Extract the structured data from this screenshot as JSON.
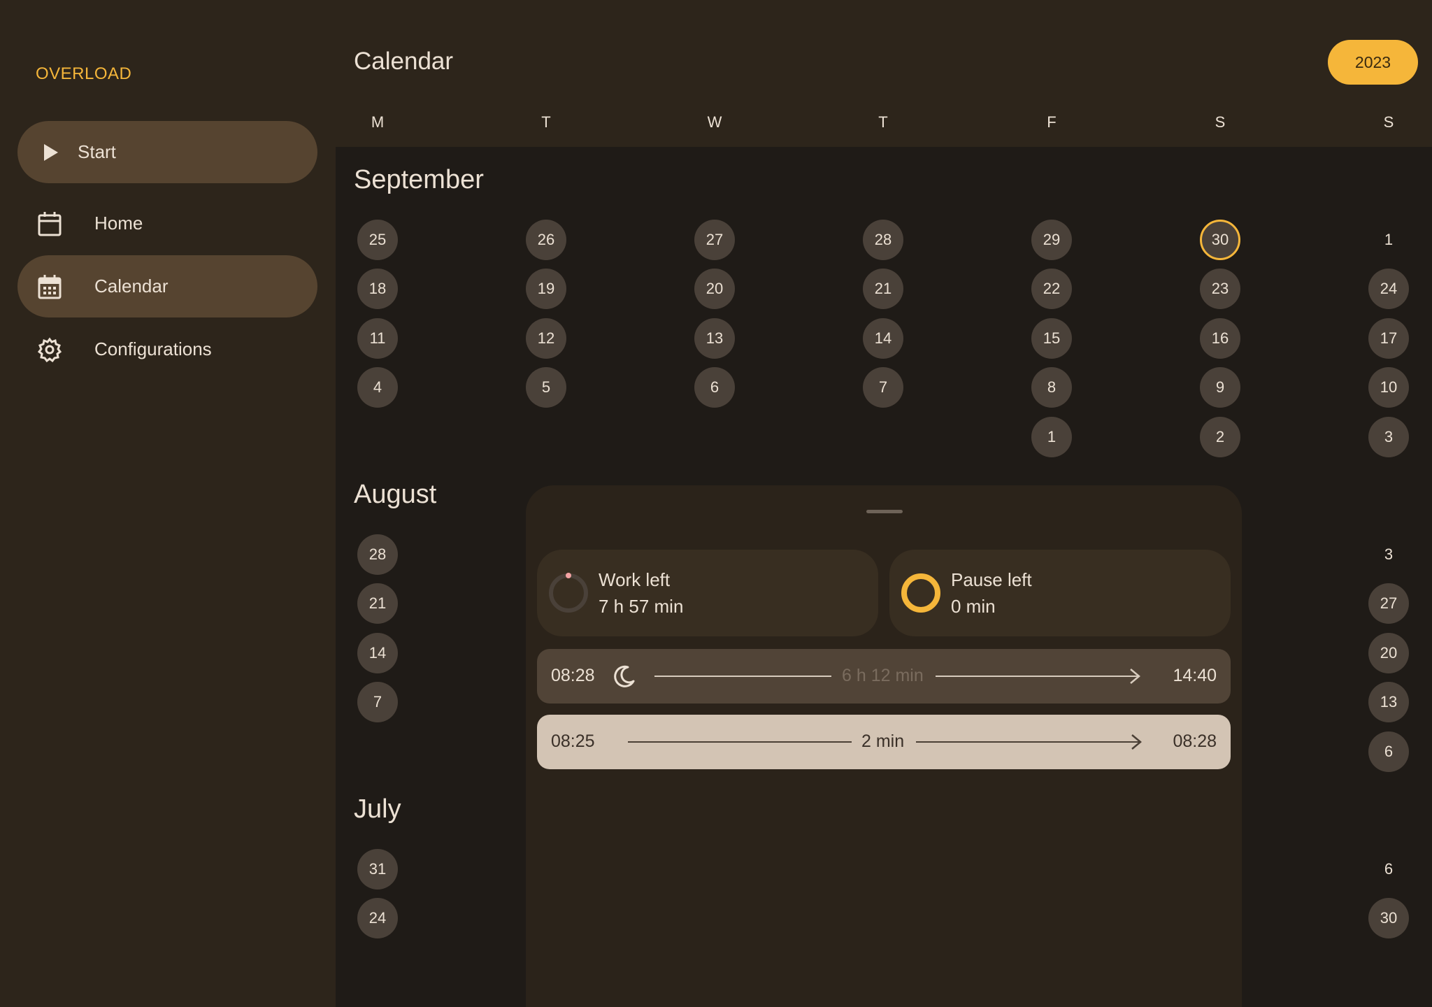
{
  "app": {
    "brand": "OVERLOAD"
  },
  "nav": {
    "start_label": "Start",
    "items": [
      {
        "label": "Home",
        "icon": "calendar-outline-icon"
      },
      {
        "label": "Calendar",
        "icon": "calendar-filled-icon",
        "active": true
      },
      {
        "label": "Configurations",
        "icon": "gear-icon"
      }
    ]
  },
  "header": {
    "title": "Calendar",
    "year": "2023"
  },
  "weekdays": [
    "M",
    "T",
    "W",
    "T",
    "F",
    "S",
    "S"
  ],
  "months": [
    {
      "name": "September",
      "rows": [
        [
          "25",
          "26",
          "27",
          "28",
          "29",
          "30",
          "1"
        ],
        [
          "18",
          "19",
          "20",
          "21",
          "22",
          "23",
          "24"
        ],
        [
          "11",
          "12",
          "13",
          "14",
          "15",
          "16",
          "17"
        ],
        [
          "4",
          "5",
          "6",
          "7",
          "8",
          "9",
          "10"
        ],
        [
          "",
          "",
          "",
          "",
          "1",
          "2",
          "3"
        ]
      ],
      "today": "30"
    },
    {
      "name": "August",
      "left_days": [
        "28",
        "21",
        "14",
        "7"
      ],
      "right_days": [
        "3",
        "27",
        "20",
        "13",
        "6"
      ]
    },
    {
      "name": "July",
      "left_days": [
        "31",
        "24"
      ],
      "right_days": [
        "6",
        "30"
      ]
    }
  ],
  "sheet": {
    "work_card": {
      "title": "Work left",
      "value": "7 h 57 min"
    },
    "pause_card": {
      "title": "Pause left",
      "value": "0 min"
    },
    "work_entry": {
      "start": "08:28",
      "duration": "6 h 12 min",
      "end": "14:40",
      "icon": "moon-icon"
    },
    "pause_entry": {
      "start": "08:25",
      "duration": "2 min",
      "end": "08:28"
    }
  },
  "colors": {
    "accent": "#f5b63a",
    "sidebar": "#2d251b",
    "background": "#1f1b17",
    "day_circle": "#4a4139",
    "work_ring_dot": "#f4a3a3"
  }
}
